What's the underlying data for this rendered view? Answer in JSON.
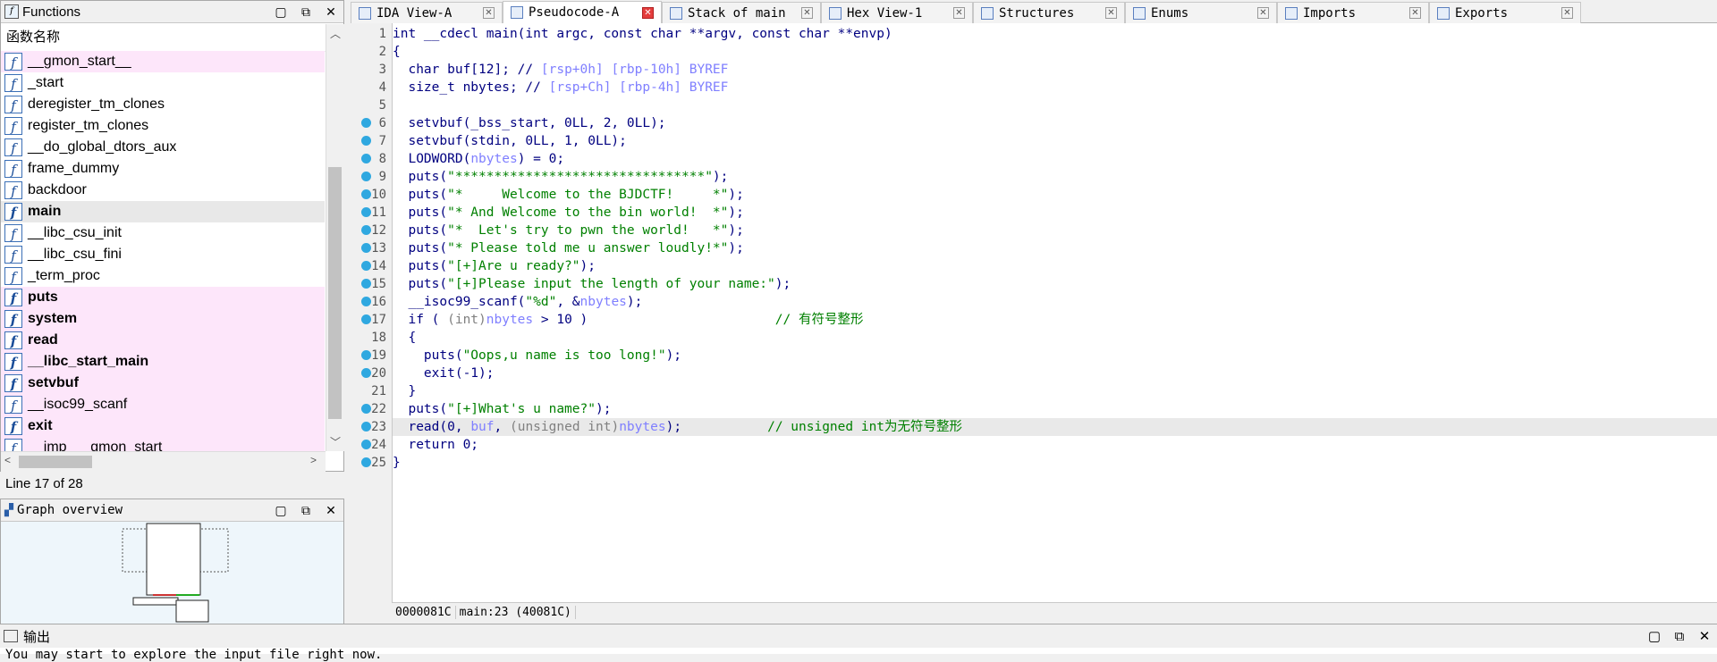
{
  "functions_panel": {
    "title": "Functions",
    "column_header": "函数名称",
    "items": [
      {
        "name": "__gmon_start__",
        "lib": true,
        "bold": false
      },
      {
        "name": "_start",
        "lib": false,
        "bold": false
      },
      {
        "name": "deregister_tm_clones",
        "lib": false,
        "bold": false
      },
      {
        "name": "register_tm_clones",
        "lib": false,
        "bold": false
      },
      {
        "name": "__do_global_dtors_aux",
        "lib": false,
        "bold": false
      },
      {
        "name": "frame_dummy",
        "lib": false,
        "bold": false
      },
      {
        "name": "backdoor",
        "lib": false,
        "bold": false
      },
      {
        "name": "main",
        "lib": false,
        "bold": true,
        "selected": true
      },
      {
        "name": "__libc_csu_init",
        "lib": false,
        "bold": false
      },
      {
        "name": "__libc_csu_fini",
        "lib": false,
        "bold": false
      },
      {
        "name": "_term_proc",
        "lib": false,
        "bold": false
      },
      {
        "name": "puts",
        "lib": true,
        "bold": true
      },
      {
        "name": "system",
        "lib": true,
        "bold": true
      },
      {
        "name": "read",
        "lib": true,
        "bold": true
      },
      {
        "name": "__libc_start_main",
        "lib": true,
        "bold": true
      },
      {
        "name": "setvbuf",
        "lib": true,
        "bold": true
      },
      {
        "name": "__isoc99_scanf",
        "lib": true,
        "bold": false
      },
      {
        "name": "exit",
        "lib": true,
        "bold": true
      },
      {
        "name": "__imp___gmon_start__",
        "lib": true,
        "bold": false
      }
    ],
    "line_status": "Line 17 of 28"
  },
  "graph_panel": {
    "title": "Graph overview"
  },
  "tabs": [
    {
      "label": "IDA View-A",
      "active": false
    },
    {
      "label": "Pseudocode-A",
      "active": true
    },
    {
      "label": "Stack of main",
      "active": false
    },
    {
      "label": "Hex View-1",
      "active": false
    },
    {
      "label": "Structures",
      "active": false
    },
    {
      "label": "Enums",
      "active": false
    },
    {
      "label": "Imports",
      "active": false
    },
    {
      "label": "Exports",
      "active": false
    }
  ],
  "code": {
    "line_numbers": [
      "1",
      "2",
      "3",
      "4",
      "5",
      "6",
      "7",
      "8",
      "9",
      "10",
      "11",
      "12",
      "13",
      "14",
      "15",
      "16",
      "17",
      "18",
      "19",
      "20",
      "21",
      "22",
      "23",
      "24",
      "25"
    ],
    "lines": {
      "l1": "int __cdecl main(int argc, const char **argv, const char **envp)",
      "l2": "{",
      "l3a": "  char buf[12]; // ",
      "l3b": "[rsp+0h] [rbp-10h] BYREF",
      "l4a": "  size_t nbytes; // ",
      "l4b": "[rsp+Ch] [rbp-4h] BYREF",
      "l5": "",
      "l6": "  setvbuf(_bss_start, 0LL, 2, 0LL);",
      "l7": "  setvbuf(stdin, 0LL, 1, 0LL);",
      "l8a": "  LODWORD(",
      "l8b": "nbytes",
      "l8c": ") = 0;",
      "l9a": "  puts(",
      "l9b": "\"********************************\"",
      "l9c": ");",
      "l10a": "  puts(",
      "l10b": "\"*     Welcome to the BJDCTF!     *\"",
      "l10c": ");",
      "l11a": "  puts(",
      "l11b": "\"* And Welcome to the bin world!  *\"",
      "l11c": ");",
      "l12a": "  puts(",
      "l12b": "\"*  Let's try to pwn the world!   *\"",
      "l12c": ");",
      "l13a": "  puts(",
      "l13b": "\"* Please told me u answer loudly!*\"",
      "l13c": ");",
      "l14a": "  puts(",
      "l14b": "\"[+]Are u ready?\"",
      "l14c": ");",
      "l15a": "  puts(",
      "l15b": "\"[+]Please input the length of your name:\"",
      "l15c": ");",
      "l16a": "  __isoc99_scanf(",
      "l16b": "\"%d\"",
      "l16c": ", &",
      "l16d": "nbytes",
      "l16e": ");",
      "l17a": "  if ( ",
      "l17b": "(int)",
      "l17c": "nbytes",
      "l17d": " > 10 )                        ",
      "l17e": "// 有符号整形",
      "l18": "  {",
      "l19a": "    puts(",
      "l19b": "\"Oops,u name is too long!\"",
      "l19c": ");",
      "l20": "    exit(-1);",
      "l21": "  }",
      "l22a": "  puts(",
      "l22b": "\"[+]What's u name?\"",
      "l22c": ");",
      "l23a": "  read(0, ",
      "l23b": "buf",
      "l23c": ", ",
      "l23d": "(unsigned int)",
      "l23e": "nbytes",
      "l23f": ");           ",
      "l23g": "// unsigned int为无符号整形",
      "l24": "  return 0;",
      "l25": "}"
    },
    "status_address": "0000081C",
    "status_location": "main:23 (40081C)"
  },
  "output_panel": {
    "title": "输出",
    "text": "You may start to explore the input file right now."
  },
  "colors": {
    "breakpoint_dot": "#2fa8e0",
    "library_function_bg": "#fde6fa",
    "active_tab_close": "#e43d3d"
  }
}
